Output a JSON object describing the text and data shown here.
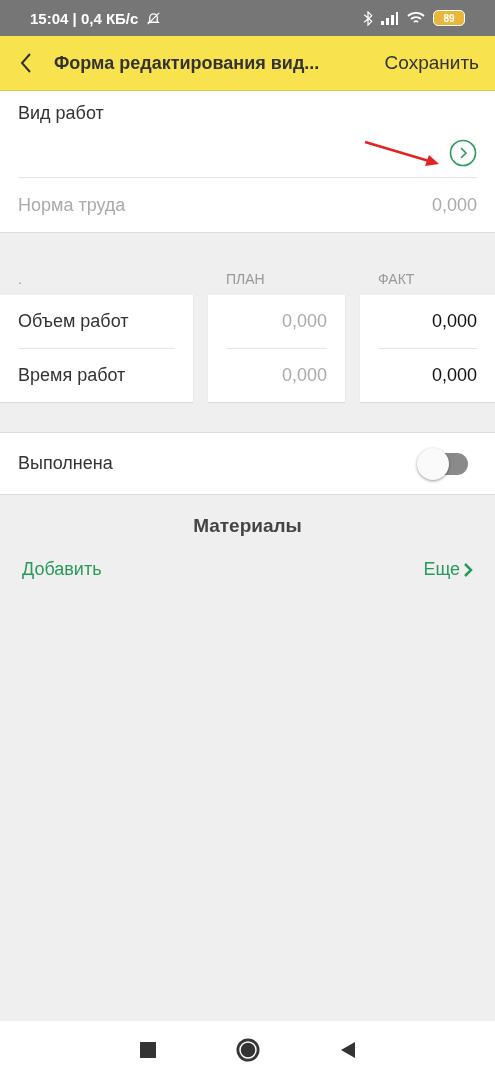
{
  "status_bar": {
    "time": "15:04 | 0,4 КБ/с",
    "battery": "89"
  },
  "header": {
    "title": "Форма редактирования вид...",
    "action": "Сохранить"
  },
  "work_type": {
    "label": "Вид работ"
  },
  "labor_norm": {
    "label": "Норма труда",
    "value": "0,000",
    "disabled": true
  },
  "table": {
    "corner": ".",
    "rows": [
      "Объем работ",
      "Время работ"
    ],
    "columns": [
      {
        "label": "ПЛАН",
        "disabled": true,
        "values": [
          "0,000",
          "0,000"
        ]
      },
      {
        "label": "ФАКТ",
        "disabled": false,
        "values": [
          "0,000",
          "0,000"
        ]
      }
    ]
  },
  "completed": {
    "label": "Выполнена",
    "on": false
  },
  "materials": {
    "title": "Материалы",
    "add": "Добавить",
    "more": "Еще"
  }
}
